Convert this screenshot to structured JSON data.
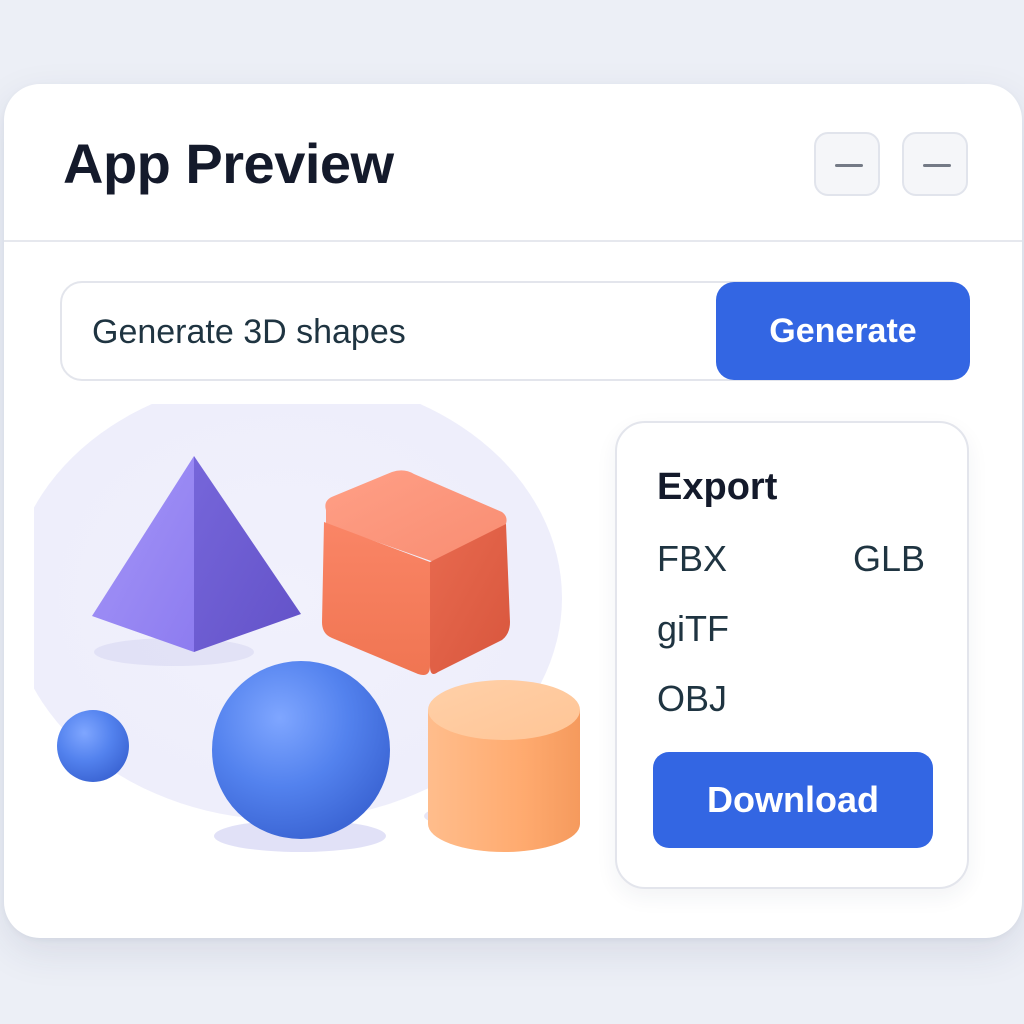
{
  "window": {
    "title": "App Preview",
    "controls": [
      {
        "icon": "minimize-icon"
      },
      {
        "icon": "minimize-icon"
      }
    ]
  },
  "prompt": {
    "value": "Generate 3D shapes",
    "button_label": "Generate"
  },
  "preview": {
    "shapes": [
      "pyramid",
      "cube",
      "sphere",
      "cylinder",
      "small-sphere"
    ]
  },
  "export": {
    "title": "Export",
    "formats": [
      "FBX",
      "GLB",
      "giTF",
      "OBJ"
    ],
    "download_label": "Download"
  },
  "colors": {
    "accent": "#3366e3",
    "background": "#eceff6",
    "pyramid": "#8b7cf0",
    "cube": "#f07a5c",
    "sphere": "#4f7ee8",
    "cylinder": "#ffab70"
  }
}
